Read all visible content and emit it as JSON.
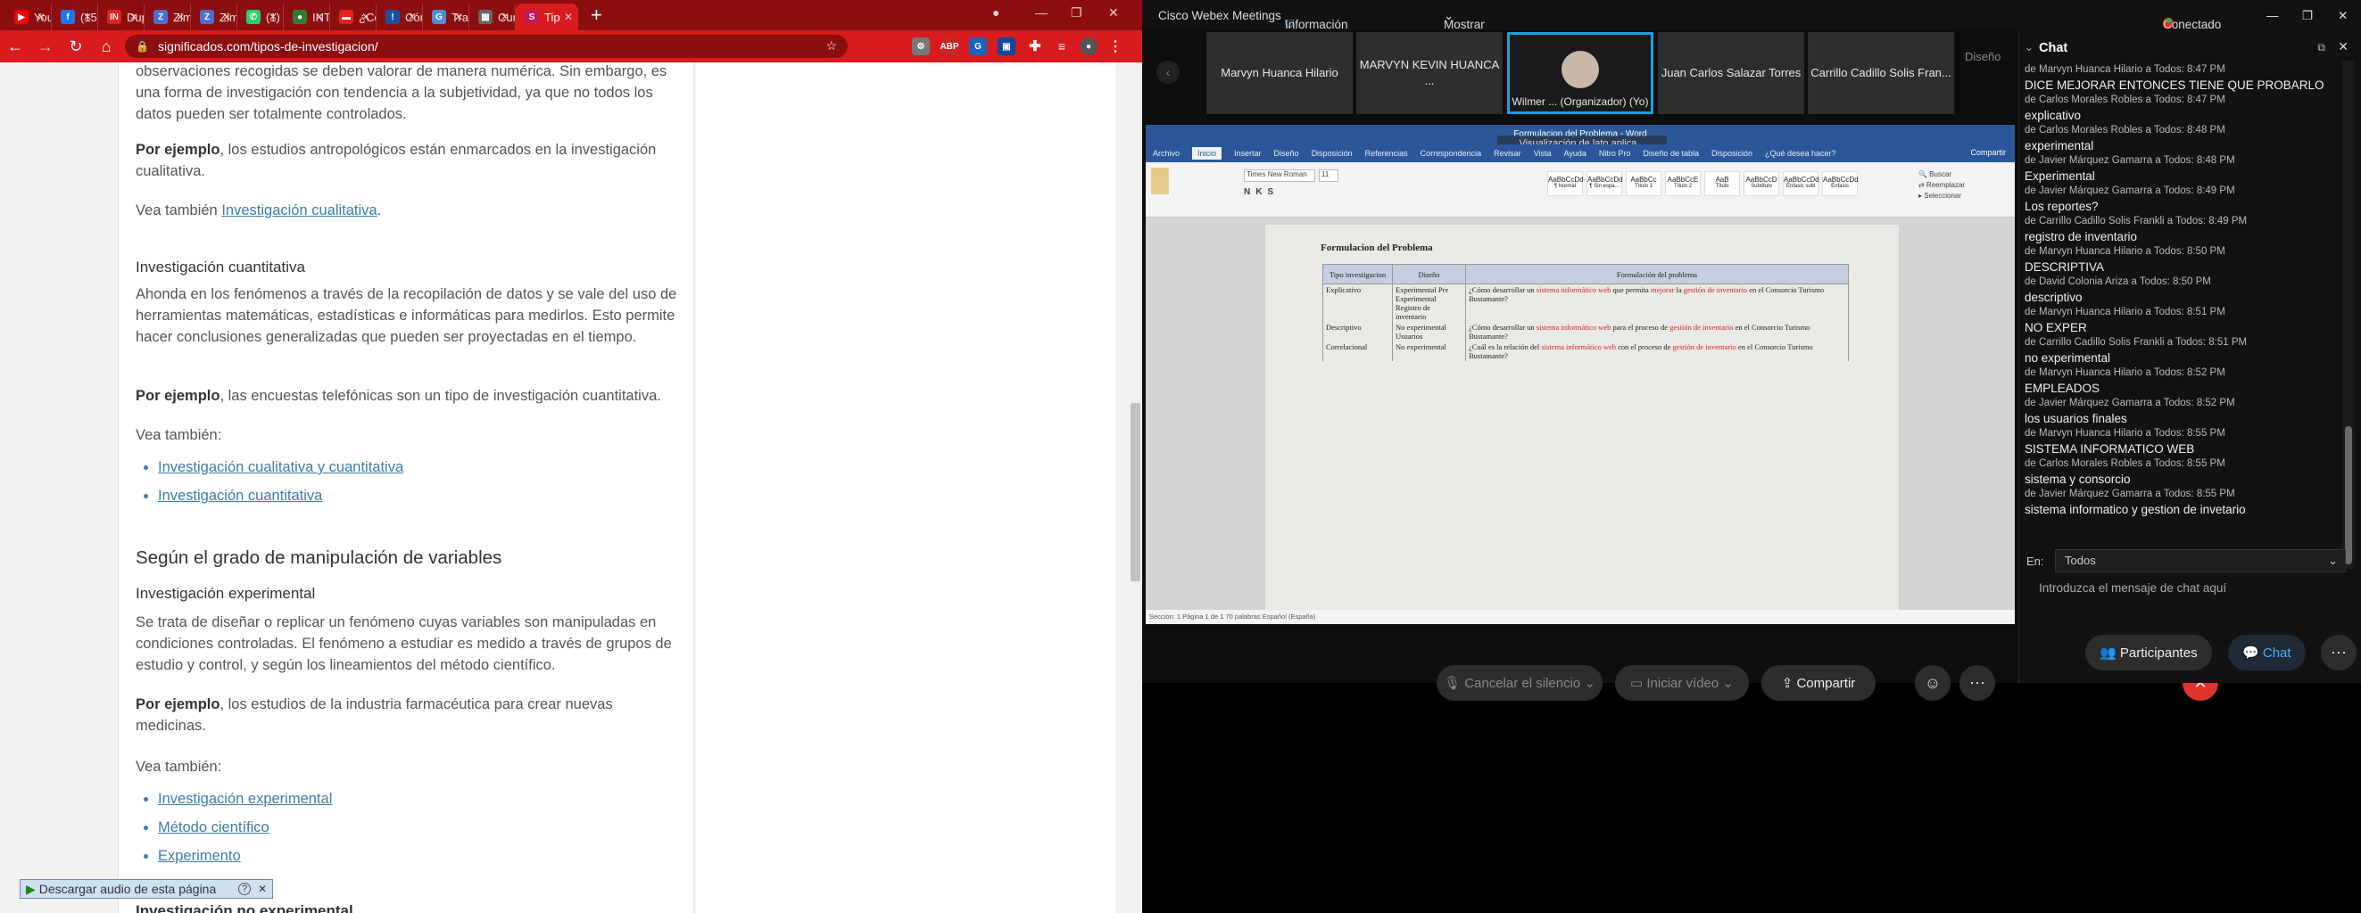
{
  "browser": {
    "tabs": [
      {
        "label": "You",
        "color": "#ff0000",
        "glyph": "▶"
      },
      {
        "label": "(15)",
        "color": "#1877f2",
        "glyph": "f"
      },
      {
        "label": "Dup",
        "color": "#e02020",
        "glyph": "IN"
      },
      {
        "label": "Zim",
        "color": "#4a6fd1",
        "glyph": "Z"
      },
      {
        "label": "Zim",
        "color": "#4a6fd1",
        "glyph": "Z"
      },
      {
        "label": "(1)",
        "color": "#25d366",
        "glyph": "✆"
      },
      {
        "label": "INT",
        "color": "#2e7d32",
        "glyph": "●"
      },
      {
        "label": "¿Có",
        "color": "#e2231a",
        "glyph": "▬"
      },
      {
        "label": "Cón",
        "color": "#1a4fa0",
        "glyph": "!"
      },
      {
        "label": "Tra",
        "color": "#4a90d9",
        "glyph": "G"
      },
      {
        "label": "Cur",
        "color": "#666666",
        "glyph": "▦"
      },
      {
        "label": "Tip",
        "color": "#c2185b",
        "glyph": "S"
      }
    ],
    "url": "significados.com/tipos-de-investigacion/"
  },
  "article": {
    "p_intro": "observaciones recogidas se deben valorar de manera numérica. Sin embargo, es una forma de investigación con tendencia a la subjetividad, ya que no todos los datos pueden ser totalmente controlados.",
    "p_example1_bold": "Por ejemplo",
    "p_example1_rest": ", los estudios antropológicos están enmarcados en la investigación cualitativa.",
    "see_also_prefix": "Vea también ",
    "see_also_link1": "Investigación cualitativa",
    "h3_cuantitativa": "Investigación cuantitativa",
    "p_cuantitativa": "Ahonda en los fenómenos a través de la recopilación de datos y se vale del uso de herramientas matemáticas, estadísticas e informáticas para medirlos. Esto permite hacer conclusiones generalizadas que pueden ser proyectadas en el tiempo.",
    "p_example2_bold": "Por ejemplo",
    "p_example2_rest": ", las encuestas telefónicas son un tipo de investigación cuantitativa.",
    "see_also_label": "Vea también:",
    "list1": [
      "Investigación cualitativa y cuantitativa",
      "Investigación cuantitativa"
    ],
    "h2_manipulacion": "Según el grado de manipulación de variables",
    "h3_experimental": "Investigación experimental",
    "p_experimental": "Se trata de diseñar o replicar un fenómeno cuyas variables son manipuladas en condiciones controladas. El fenómeno a estudiar es medido a través de grupos de estudio y control, y según los lineamientos del método científico.",
    "p_example3_bold": "Por ejemplo",
    "p_example3_rest": ", los estudios de la industria farmacéutica para crear nuevas medicinas.",
    "list2": [
      "Investigación experimental",
      "Método científico",
      "Experimento"
    ],
    "h3_noexp": "Investigación no experimental",
    "audio_label": "Descargar audio de esta página"
  },
  "webex": {
    "app_title": "Cisco Webex Meetings",
    "meeting_info": "Información de la reunión",
    "show_menu": "Mostrar la barra de menú",
    "status": "Conectado",
    "participants_tiles": [
      "Marvyn Huanca Hilario",
      "MARVYN KEVIN HUANCA ...",
      "Wilmer ... (Organizador) (Yo)",
      "Juan Carlos Salazar Torres",
      "Carrillo Cadillo Solis Fran..."
    ],
    "layout_label": "Diseño",
    "share_overlay": "Visualización de lato aplica...",
    "word": {
      "title": "Formulacion del Problema - Word",
      "tabs": [
        "Archivo",
        "Inicio",
        "Insertar",
        "Diseño",
        "Disposición",
        "Referencias",
        "Correspondencia",
        "Revisar",
        "Vista",
        "Ayuda",
        "Nitro Pro",
        "Diseño de tabla",
        "Disposición",
        "¿Qué desea hacer?"
      ],
      "share": "Compartir",
      "font": "Times New Roman",
      "size": "11",
      "styles": [
        "AaBbCcDd",
        "AaBbCcDd",
        "AaBbCc",
        "AaBbCcE",
        "AaB",
        "AaBbCcD",
        "AaBbCcDd",
        "AaBbCcDd"
      ],
      "style_names": [
        "¶ Normal",
        "¶ Sin espa...",
        "Título 1",
        "Título 2",
        "Título",
        "Subtítulo",
        "Énfasis sutil",
        "Énfasis"
      ],
      "doc_title": "Formulacion del Problema",
      "table_headers": [
        "Tipo investigacion",
        "Diseño",
        "Formulación del problema"
      ],
      "rows": [
        {
          "tipo": "Explicativo",
          "diseno": "Experimental Pre Experimental Registro de inventario",
          "formulacion": "¿Cómo desarrollar un sistema informático web que permita mejorar la gestión de inventario en el Consorcio Turismo Bustamante?"
        },
        {
          "tipo": "Descriptivo",
          "diseno": "No experimental Usuarios",
          "formulacion": "¿Cómo desarrollar un sistema informático web para el proceso de gestión de inventario en el Consorcio Turismo Bustamante?"
        },
        {
          "tipo": "Correlacional",
          "diseno": "No experimental",
          "formulacion": "¿Cuál es la relación del sistema informático web con el proceso de gestión de inventario en el Consorcio Turismo Bustamante?"
        }
      ],
      "statusbar": "Sección: 1   Página 1 de 1   70 palabras   Español (España)"
    },
    "controls": {
      "mute": "Cancelar el silencio",
      "video": "Iniciar vídeo",
      "share": "Compartir",
      "participants": "Participantes",
      "chat": "Chat"
    },
    "chat": {
      "title": "Chat",
      "messages": [
        {
          "meta": "de Marvyn Huanca Hilario a Todos:   8:47 PM",
          "text": "DICE MEJORAR ENTONCES TIENE QUE PROBARLO"
        },
        {
          "meta": "de Carlos Morales Robles a Todos:   8:47 PM",
          "text": "explicativo"
        },
        {
          "meta": "de Carlos Morales Robles a Todos:   8:48 PM",
          "text": "experimental"
        },
        {
          "meta": "de Javier Márquez Gamarra a Todos:   8:48 PM",
          "text": "Experimental"
        },
        {
          "meta": "de Javier Márquez Gamarra a Todos:   8:49 PM",
          "text": "Los reportes?"
        },
        {
          "meta": "de Carrillo Cadillo Solis Frankli a Todos:   8:49 PM",
          "text": "registro de inventario"
        },
        {
          "meta": "de Marvyn Huanca Hilario a Todos:   8:50 PM",
          "text": "DESCRIPTIVA"
        },
        {
          "meta": "de David Colonia Ariza a Todos:   8:50 PM",
          "text": "descriptivo"
        },
        {
          "meta": "de Marvyn Huanca Hilario a Todos:   8:51 PM",
          "text": "NO EXPER"
        },
        {
          "meta": "de Carrillo Cadillo Solis Frankli a Todos:   8:51 PM",
          "text": "no experimental"
        },
        {
          "meta": "de Marvyn Huanca Hilario a Todos:   8:52 PM",
          "text": "EMPLEADOS"
        },
        {
          "meta": "de Javier Márquez Gamarra a Todos:   8:52 PM",
          "text": "los usuarios finales"
        },
        {
          "meta": "de Marvyn Huanca Hilario a Todos:   8:55 PM",
          "text": "SISTEMA INFORMATICO WEB"
        },
        {
          "meta": "de Carlos Morales Robles a Todos:   8:55 PM",
          "text": "sistema y consorcio"
        },
        {
          "meta": "de Javier Márquez Gamarra a Todos:   8:55 PM",
          "text": "sistema informatico y gestion de invetario"
        }
      ],
      "to_label": "En:",
      "to_value": "Todos",
      "input_placeholder": "Introduzca el mensaje de chat aquí"
    }
  }
}
